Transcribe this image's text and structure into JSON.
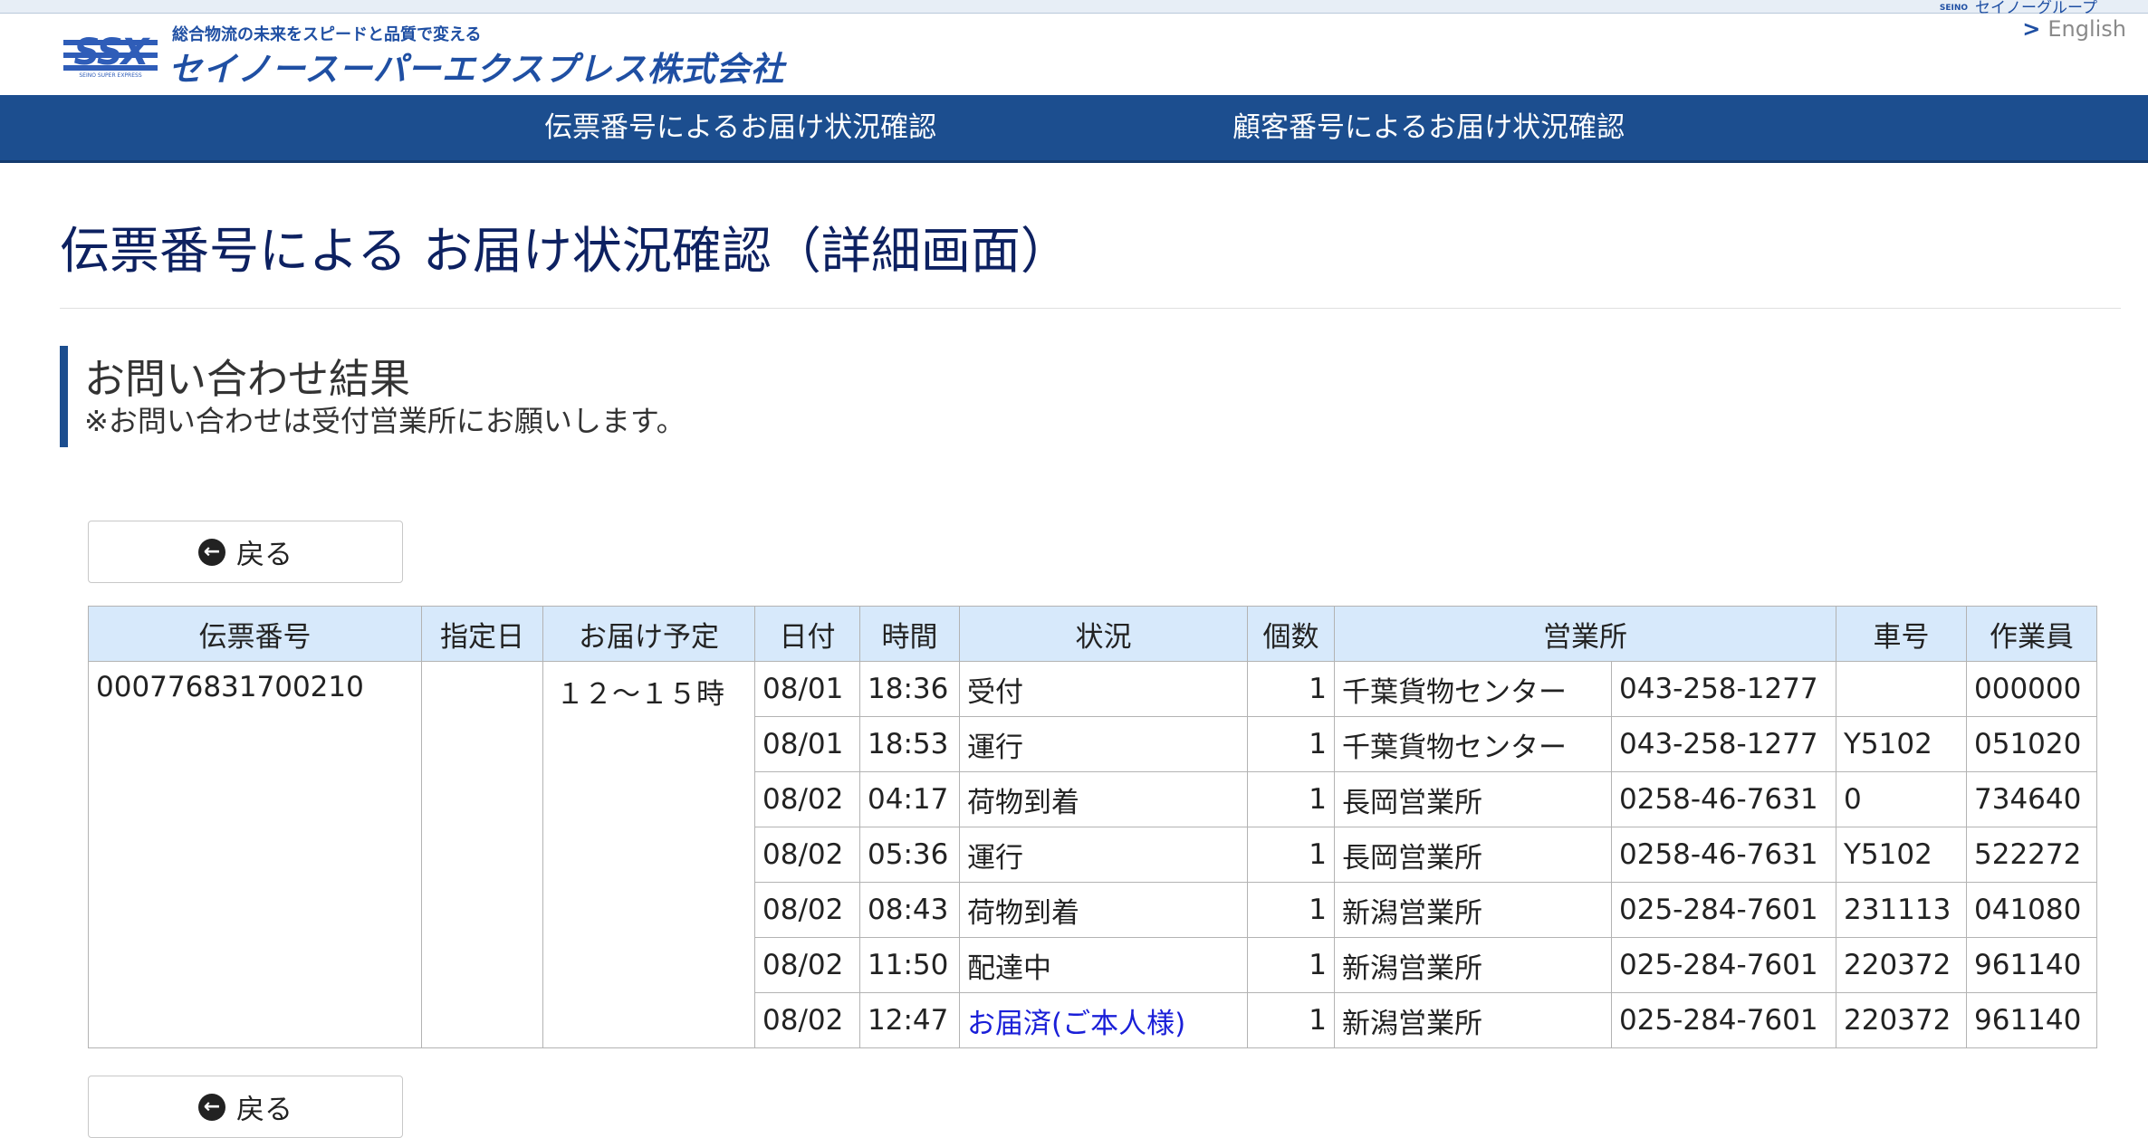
{
  "header": {
    "group_link": "セイノーグループ",
    "group_badge": "SEINO",
    "english_link": "English",
    "logo": {
      "mark": "SSX",
      "mark_sub": "SEINO SUPER EXPRESS",
      "tagline": "総合物流の未来をスピードと品質で変える",
      "company_name": "セイノースーパーエクスプレス株式会社"
    }
  },
  "nav": {
    "items": [
      {
        "label": "伝票番号によるお届け状況確認"
      },
      {
        "label": "顧客番号によるお届け状況確認"
      }
    ]
  },
  "page": {
    "title": "伝票番号による お届け状況確認（詳細画面）",
    "result_title": "お問い合わせ結果",
    "result_note": "※お問い合わせは受付営業所にお願いします。",
    "back_label": "戻る"
  },
  "table": {
    "headers": {
      "slip_no": "伝票番号",
      "designated_date": "指定日",
      "delivery_schedule": "お届け予定",
      "date": "日付",
      "time": "時間",
      "status": "状況",
      "quantity": "個数",
      "office": "営業所",
      "vehicle_no": "車号",
      "worker": "作業員"
    },
    "slip_no": "000776831700210",
    "designated_date": "",
    "delivery_schedule": "１２～１５時",
    "rows": [
      {
        "date": "08/01",
        "time": "18:36",
        "status": "受付",
        "quantity": "1",
        "office": "千葉貨物センター",
        "phone": "043-258-1277",
        "vehicle": "",
        "worker": "000000"
      },
      {
        "date": "08/01",
        "time": "18:53",
        "status": "運行",
        "quantity": "1",
        "office": "千葉貨物センター",
        "phone": "043-258-1277",
        "vehicle": "Y5102",
        "worker": "051020"
      },
      {
        "date": "08/02",
        "time": "04:17",
        "status": "荷物到着",
        "quantity": "1",
        "office": "長岡営業所",
        "phone": "0258-46-7631",
        "vehicle": "0",
        "worker": "734640"
      },
      {
        "date": "08/02",
        "time": "05:36",
        "status": "運行",
        "quantity": "1",
        "office": "長岡営業所",
        "phone": "0258-46-7631",
        "vehicle": "Y5102",
        "worker": "522272"
      },
      {
        "date": "08/02",
        "time": "08:43",
        "status": "荷物到着",
        "quantity": "1",
        "office": "新潟営業所",
        "phone": "025-284-7601",
        "vehicle": "231113",
        "worker": "041080"
      },
      {
        "date": "08/02",
        "time": "11:50",
        "status": "配達中",
        "quantity": "1",
        "office": "新潟営業所",
        "phone": "025-284-7601",
        "vehicle": "220372",
        "worker": "961140"
      },
      {
        "date": "08/02",
        "time": "12:47",
        "status": "お届済(ご本人様)",
        "quantity": "1",
        "office": "新潟営業所",
        "phone": "025-284-7601",
        "vehicle": "220372",
        "worker": "961140"
      }
    ]
  },
  "colors": {
    "brand_blue": "#1c4e8f",
    "title_navy": "#0d2161",
    "header_cell_bg": "#d7e9fb",
    "delivered_link": "#1a1fd8"
  },
  "icons": {
    "back": "arrow-circle-left-icon",
    "english": "chevron-right-icon"
  }
}
